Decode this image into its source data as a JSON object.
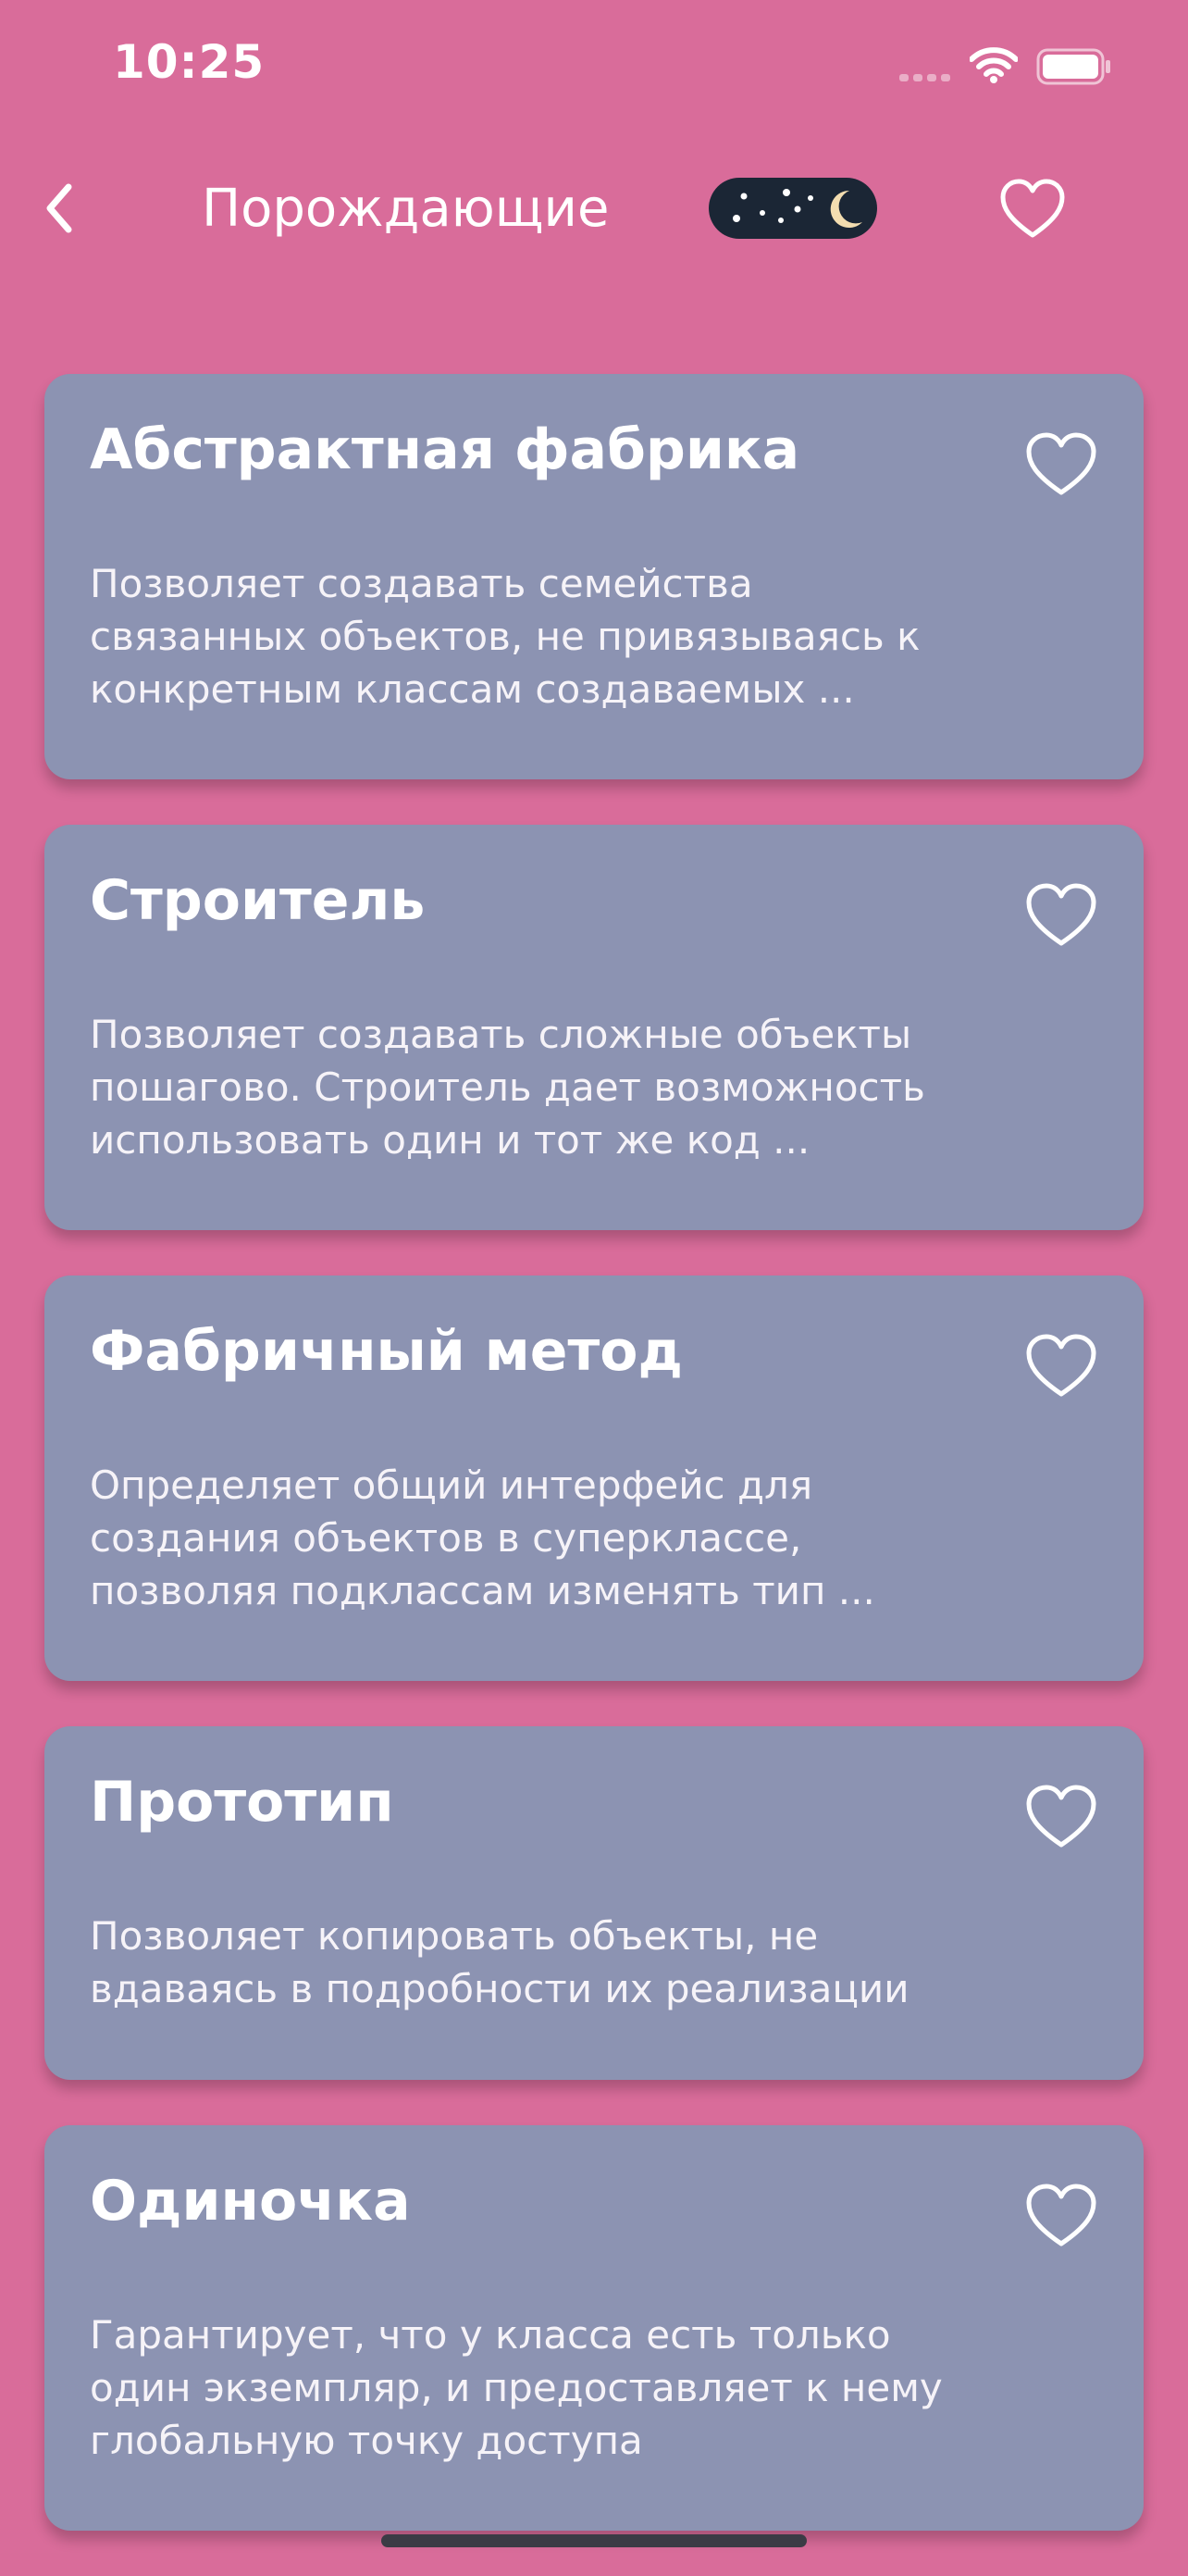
{
  "status_bar": {
    "time": "10:25"
  },
  "nav": {
    "title": "Порождающие",
    "back_icon": "chevron-left-icon",
    "favorites_icon": "heart-outline-icon",
    "theme_toggle_icon": "night-moon-icon"
  },
  "colors": {
    "background": "#D96C9A",
    "card": "#8C93B2",
    "toggle": "#1B2635",
    "text": "#FFFFFF"
  },
  "cards": [
    {
      "title": "Абстрактная фабрика",
      "description": "Позволяет создавать семейства\nсвязанных объектов, не привязываясь к\nконкретным классам создаваемых ..."
    },
    {
      "title": "Строитель",
      "description": "Позволяет создавать сложные объекты\nпошагово. Строитель дает возможность\nиспользовать один и тот же код ..."
    },
    {
      "title": "Фабричный метод",
      "description": "Определяет общий интерфейс для\nсоздания объектов в суперклассе,\nпозволяя подклассам изменять тип ..."
    },
    {
      "title": "Прототип",
      "description": "Позволяет копировать объекты, не\nвдаваясь в подробности их реализации"
    },
    {
      "title": "Одиночка",
      "description": "Гарантирует, что у класса есть только\nодин экземпляр, и предоставляет к нему\nглобальную точку доступа"
    }
  ]
}
